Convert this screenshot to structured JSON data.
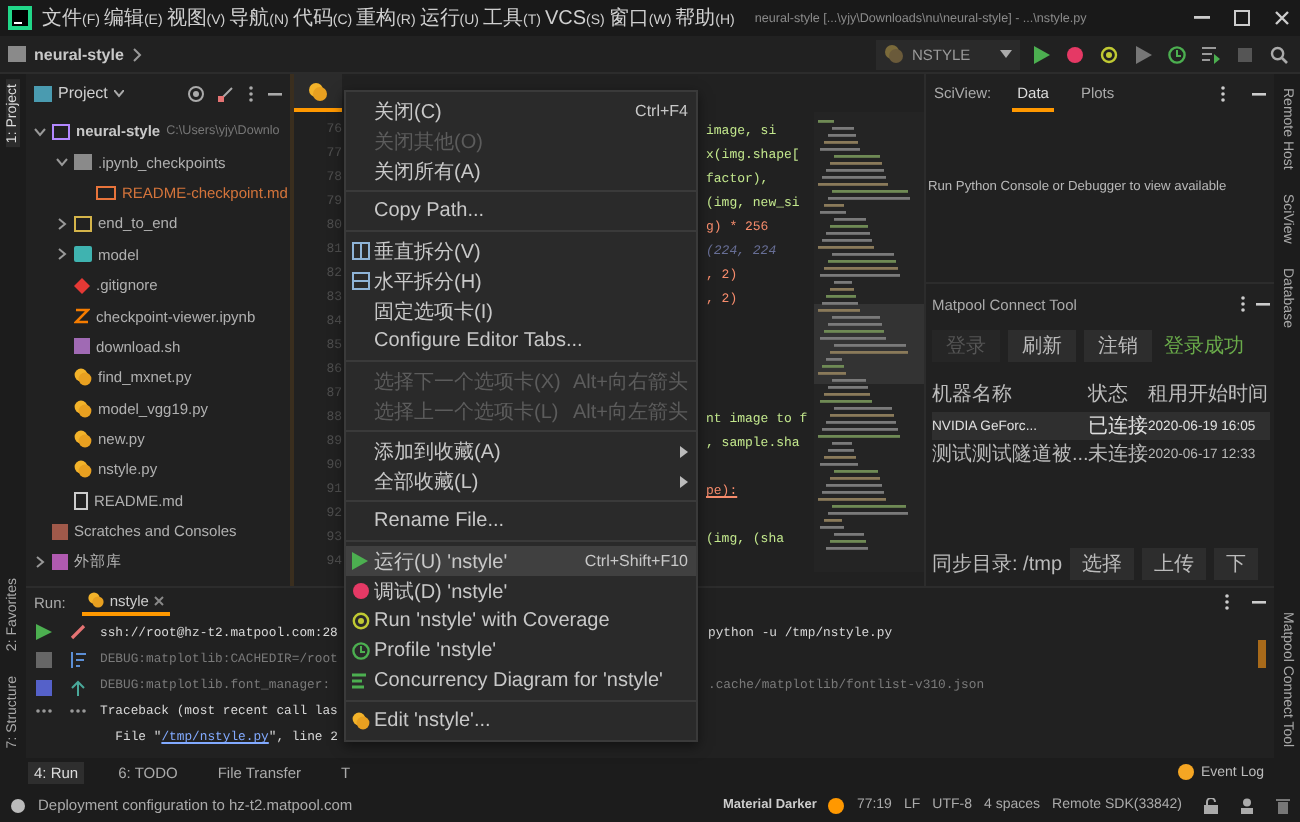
{
  "menu_bar": {
    "items": [
      {
        "label": "文件",
        "mnemonic": "(F)"
      },
      {
        "label": "编辑",
        "mnemonic": "(E)"
      },
      {
        "label": "视图",
        "mnemonic": "(V)"
      },
      {
        "label": "导航",
        "mnemonic": "(N)"
      },
      {
        "label": "代码",
        "mnemonic": "(C)"
      },
      {
        "label": "重构",
        "mnemonic": "(R)"
      },
      {
        "label": "运行",
        "mnemonic": "(U)"
      },
      {
        "label": "工具",
        "mnemonic": "(T)"
      },
      {
        "label": "VCS",
        "mnemonic": "(S)"
      },
      {
        "label": "窗口",
        "mnemonic": "(W)"
      },
      {
        "label": "帮助",
        "mnemonic": "(H)"
      }
    ],
    "title": "neural-style [...\\yjy\\Downloads\\nu\\neural-style] - ...\\nstyle.py"
  },
  "nav_bar": {
    "breadcrumb": "neural-style",
    "run_config": "NSTYLE"
  },
  "left_stripe": {
    "top": [
      {
        "label": "1: Project",
        "selected": true
      }
    ],
    "bottom": [
      {
        "label": "7: Structure",
        "selected": false
      },
      {
        "label": "2: Favorites",
        "selected": false
      }
    ]
  },
  "project": {
    "title": "Project",
    "tree": [
      {
        "kind": "root",
        "label": "neural-style",
        "path": "C:\\Users\\yjy\\Downlo",
        "expanded": true,
        "children": [
          {
            "kind": "folder",
            "label": ".ipynb_checkpoints",
            "expanded": true,
            "children": [
              {
                "kind": "md",
                "label": "README-checkpoint.md"
              }
            ]
          },
          {
            "kind": "package",
            "label": "end_to_end",
            "expanded": false
          },
          {
            "kind": "module",
            "label": "model",
            "expanded": false
          },
          {
            "kind": "git",
            "label": ".gitignore"
          },
          {
            "kind": "notebook",
            "label": "checkpoint-viewer.ipynb"
          },
          {
            "kind": "shell",
            "label": "download.sh"
          },
          {
            "kind": "python",
            "label": "find_mxnet.py"
          },
          {
            "kind": "python",
            "label": "model_vgg19.py"
          },
          {
            "kind": "python",
            "label": "new.py"
          },
          {
            "kind": "python",
            "label": "nstyle.py"
          },
          {
            "kind": "readme",
            "label": "README.md"
          }
        ]
      },
      {
        "kind": "scratches",
        "label": "Scratches and Consoles"
      },
      {
        "kind": "library",
        "label": "外部库",
        "expanded": false
      }
    ]
  },
  "editor": {
    "lines": [
      {
        "number": "76",
        "kind": "plain",
        "code": "image, si"
      },
      {
        "number": "77",
        "kind": "plain",
        "code": "x(img.shape["
      },
      {
        "number": "78",
        "kind": "plain",
        "code": "factor),"
      },
      {
        "number": "79",
        "kind": "plain",
        "code": "(img, new_si"
      },
      {
        "number": "80",
        "kind": "number",
        "code": "g) * 256"
      },
      {
        "number": "81",
        "kind": "comment",
        "code": "(224, 224"
      },
      {
        "number": "82",
        "kind": "number",
        "code": ", 2)"
      },
      {
        "number": "83",
        "kind": "number",
        "code": ", 2)"
      },
      {
        "number": "84"
      },
      {
        "number": "85"
      },
      {
        "number": "86"
      },
      {
        "number": "87"
      },
      {
        "number": "88",
        "kind": "string",
        "code": "nt image to f"
      },
      {
        "number": "89",
        "kind": "plain",
        "code": ", sample.sha"
      },
      {
        "number": "90"
      },
      {
        "number": "91",
        "kind": "keyword",
        "code": "pe):"
      },
      {
        "number": "92"
      },
      {
        "number": "93",
        "kind": "plain",
        "code": "(img, (sha"
      },
      {
        "number": "94"
      }
    ]
  },
  "context_menu": {
    "groups": [
      [
        {
          "kind": "plain",
          "label": "关闭(C)",
          "shortcut": "Ctrl+F4",
          "disabled": false,
          "selected": false
        },
        {
          "kind": "plain",
          "label": "关闭其他(O)",
          "disabled": true,
          "selected": false
        },
        {
          "kind": "plain",
          "label": "关闭所有(A)",
          "disabled": false,
          "selected": false
        }
      ],
      [
        {
          "kind": "plain",
          "label": "Copy Path...",
          "disabled": false,
          "selected": false
        }
      ],
      [
        {
          "kind": "vsplit",
          "label": "垂直拆分(V)",
          "disabled": false,
          "selected": false
        },
        {
          "kind": "hsplit",
          "label": "水平拆分(H)",
          "disabled": false,
          "selected": false
        },
        {
          "kind": "plain",
          "label": "固定选项卡(I)",
          "disabled": false,
          "selected": false
        },
        {
          "kind": "plain",
          "label": "Configure Editor Tabs...",
          "disabled": false,
          "selected": false
        }
      ],
      [
        {
          "kind": "plain",
          "label": "选择下一个选项卡(X)",
          "shortcut": "Alt+向右箭头",
          "disabled": true,
          "selected": false
        },
        {
          "kind": "plain",
          "label": "选择上一个选项卡(L)",
          "shortcut": "Alt+向左箭头",
          "disabled": true,
          "selected": false
        }
      ],
      [
        {
          "kind": "plain",
          "label": "添加到收藏(A)",
          "submenu": true,
          "disabled": false,
          "selected": false
        },
        {
          "kind": "plain",
          "label": "全部收藏(L)",
          "submenu": true,
          "disabled": false,
          "selected": false
        }
      ],
      [
        {
          "kind": "plain",
          "label": "Rename File...",
          "disabled": false,
          "selected": false
        }
      ],
      [
        {
          "kind": "run",
          "label": "运行(U) 'nstyle'",
          "shortcut": "Ctrl+Shift+F10",
          "disabled": false,
          "selected": true
        },
        {
          "kind": "debug",
          "label": "调试(D) 'nstyle'",
          "disabled": false,
          "selected": false
        },
        {
          "kind": "coverage",
          "label": "Run 'nstyle' with Coverage",
          "disabled": false,
          "selected": false
        },
        {
          "kind": "profile",
          "label": "Profile 'nstyle'",
          "disabled": false,
          "selected": false
        },
        {
          "kind": "concurrency",
          "label": "Concurrency Diagram for 'nstyle'",
          "disabled": false,
          "selected": false
        }
      ],
      [
        {
          "kind": "edit",
          "label": "Edit 'nstyle'...",
          "disabled": false,
          "selected": false
        }
      ]
    ]
  },
  "sciview": {
    "title": "SciView:",
    "tabs": [
      {
        "label": "Data",
        "selected": true
      },
      {
        "label": "Plots",
        "selected": false
      }
    ],
    "message": "Run Python Console or Debugger to view available"
  },
  "matpool": {
    "title": "Matpool Connect Tool",
    "buttons": [
      {
        "label": "登录",
        "disabled": true
      },
      {
        "label": "刷新",
        "disabled": false
      },
      {
        "label": "注销",
        "disabled": false
      }
    ],
    "status": "登录成功",
    "columns": [
      "机器名称",
      "状态",
      "租用开始时间"
    ],
    "rows": [
      {
        "cells": [
          "NVIDIA GeForc...",
          "已连接",
          "2020-06-19 16:05"
        ],
        "selected": true
      },
      {
        "cells": [
          "测试测试隧道被...",
          "未连接",
          "2020-06-17 12:33"
        ],
        "selected": false
      }
    ],
    "sync_label": "同步目录: /tmp",
    "sync_buttons": [
      "选择",
      "上传",
      "下"
    ]
  },
  "right_stripe": {
    "top": [
      "Remote Host",
      "SciView",
      "Database"
    ],
    "bottom": [
      "Matpool Connect Tool"
    ]
  },
  "run_panel": {
    "label": "Run:",
    "tab": "nstyle",
    "lines": [
      {
        "kind": "command",
        "left": "ssh://root@hz-t2.matpool.com:28",
        "right": "python -u /tmp/nstyle.py"
      },
      {
        "kind": "debug",
        "left": "DEBUG:matplotlib:CACHEDIR=/root"
      },
      {
        "kind": "debug",
        "left": "DEBUG:matplotlib.font_manager:",
        "right": ".cache/matplotlib/fontlist-v310.json"
      },
      {
        "kind": "error",
        "left": "Traceback (most recent call las"
      },
      {
        "kind": "file",
        "prefix": "  File \"",
        "link": "/tmp/nstyle.py",
        "suffix": "\", line 2"
      }
    ]
  },
  "tool_tabs": [
    {
      "label": "4: Run",
      "selected": true
    },
    {
      "label": "6: TODO",
      "selected": false
    },
    {
      "label": "File Transfer",
      "selected": false
    },
    {
      "label": "T",
      "selected": false
    }
  ],
  "event_log": "Event Log",
  "status_bar": {
    "message": "Deployment configuration to hz-t2.matpool.com",
    "theme": "Material Darker",
    "items": [
      "77:19",
      "LF",
      "UTF-8",
      "4 spaces",
      "Remote SDK(33842)"
    ]
  }
}
